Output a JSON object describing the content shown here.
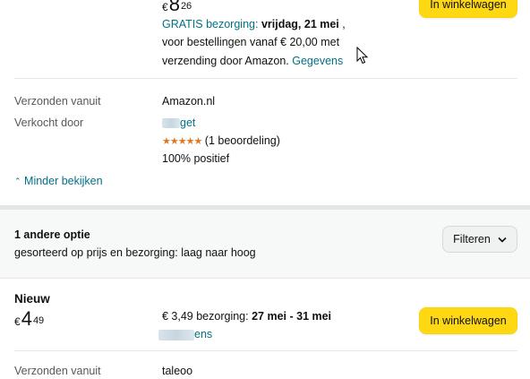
{
  "offer1": {
    "currency": "€",
    "price_whole": "8",
    "price_fraction": "26",
    "cart_button": "In winkelwagen",
    "free_delivery_link": "GRATIS bezorging:",
    "delivery_date": "vrijdag, 21 mei",
    "delivery_suffix": " ,",
    "delivery_line2": "voor bestellingen vanaf € 20,00 met",
    "delivery_line3": "verzending door Amazon.",
    "details_link": "Gegevens",
    "ships_from_label": "Verzonden vanuit",
    "ships_from_value": "Amazon.nl",
    "sold_by_label": "Verkocht door",
    "seller_name_suffix": "get",
    "stars": "★★★★★",
    "rating_count": "(1 beoordeling)",
    "positive": "100% positief",
    "show_less": "Minder bekijken"
  },
  "options": {
    "title": "1 andere optie",
    "sort_text": "gesorteerd op prijs en bezorging: laag naar hoog",
    "filter_button": "Filteren"
  },
  "offer2": {
    "condition": "Nieuw",
    "currency": "€",
    "price_whole": "4",
    "price_fraction": "49",
    "delivery_price": "€ 3,49 bezorging:",
    "delivery_date": "27 mei - 31 mei",
    "seller_name_suffix": "ens",
    "cart_button": "In winkelwagen",
    "ships_from_label": "Verzonden vanuit",
    "ships_from_value": "taleoo"
  },
  "colors": {
    "link": "#007185",
    "button": "#ffd814",
    "star": "#de7921",
    "section_bg": "#f7f8f8"
  }
}
